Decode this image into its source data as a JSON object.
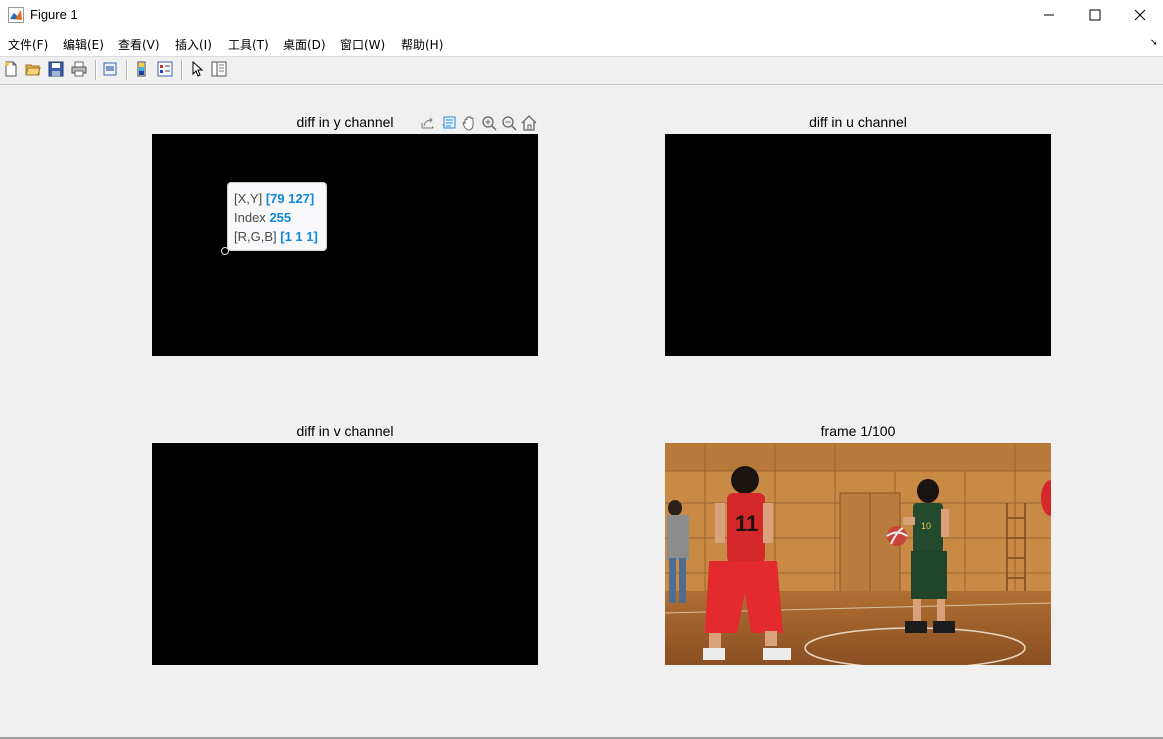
{
  "window": {
    "title": "Figure 1"
  },
  "menu": [
    {
      "label": "文件(F)"
    },
    {
      "label": "编辑(E)"
    },
    {
      "label": "查看(V)"
    },
    {
      "label": "插入(I)"
    },
    {
      "label": "工具(T)"
    },
    {
      "label": "桌面(D)"
    },
    {
      "label": "窗口(W)"
    },
    {
      "label": "帮助(H)"
    }
  ],
  "toolbar_icons": [
    "new-figure-icon",
    "open-file-icon",
    "save-icon",
    "print-icon",
    "print-preview-icon",
    "colorbar-icon",
    "legend-icon",
    "pointer-icon",
    "property-inspector-icon"
  ],
  "axes_toolbar_icons": [
    "export-icon",
    "datatip-icon",
    "pan-icon",
    "zoom-in-icon",
    "zoom-out-icon",
    "home-icon"
  ],
  "panels": {
    "y": {
      "title": "diff in y channel"
    },
    "u": {
      "title": "diff in u channel"
    },
    "v": {
      "title": "diff in v channel"
    },
    "frame": {
      "title": "frame 1/100"
    }
  },
  "datatip": {
    "xy_label": "[X,Y]",
    "xy_value": "[79 127]",
    "index_label": "Index",
    "index_value": "255",
    "rgb_label": "[R,G,B]",
    "rgb_value": "[1 1 1]"
  },
  "colors": {
    "accent": "#0f88d9",
    "figure_bg": "#f0f0f0",
    "image_bg": "#000000"
  }
}
